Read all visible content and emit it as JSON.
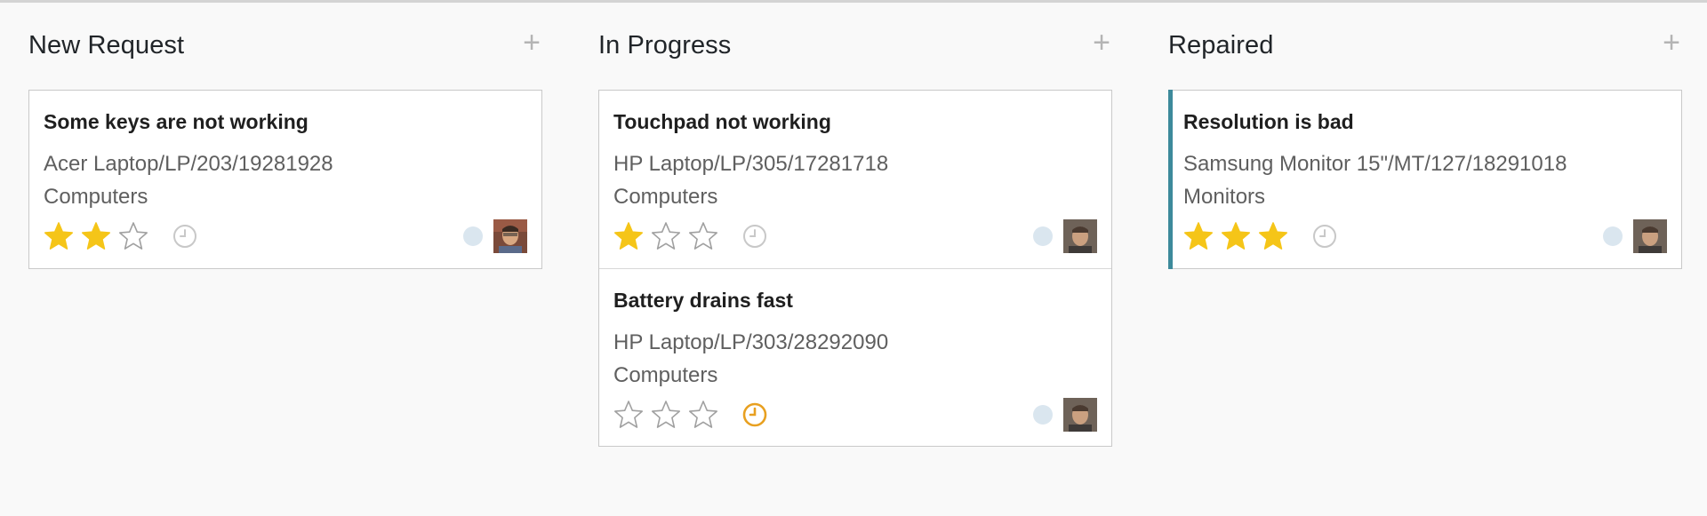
{
  "columns": [
    {
      "title": "New Request",
      "add_label": "+",
      "cards": [
        {
          "title": "Some keys are not working",
          "equipment": "Acer Laptop/LP/203/19281928",
          "category": "Computers",
          "priority": 2,
          "activity_icon": "clock-icon",
          "activity_color": "#c8c8c8",
          "accent": false
        }
      ]
    },
    {
      "title": "In Progress",
      "add_label": "+",
      "cards": [
        {
          "title": "Touchpad not working",
          "equipment": "HP Laptop/LP/305/17281718",
          "category": "Computers",
          "priority": 1,
          "activity_icon": "clock-icon",
          "activity_color": "#c8c8c8",
          "accent": false
        },
        {
          "title": "Battery drains fast",
          "equipment": "HP Laptop/LP/303/28292090",
          "category": "Computers",
          "priority": 0,
          "activity_icon": "clock-icon",
          "activity_color": "#e8a020",
          "accent": false
        }
      ]
    },
    {
      "title": "Repaired",
      "add_label": "+",
      "cards": [
        {
          "title": "Resolution is bad",
          "equipment": "Samsung Monitor 15\"/MT/127/18291018",
          "category": "Monitors",
          "priority": 3,
          "activity_icon": "clock-icon",
          "activity_color": "#c8c8c8",
          "accent": true
        }
      ]
    }
  ],
  "colors": {
    "star_filled": "#f5c518",
    "star_empty": "#a0a0a0",
    "accent": "#3d8a9b",
    "state_dot": "#dae6ef"
  },
  "max_priority": 3
}
